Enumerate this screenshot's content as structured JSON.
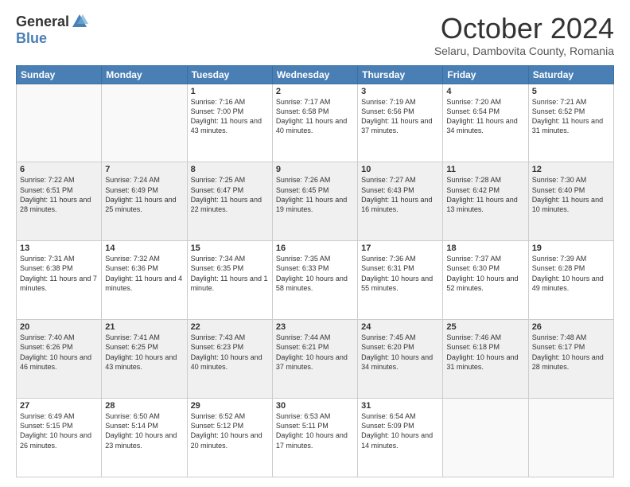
{
  "logo": {
    "general": "General",
    "blue": "Blue"
  },
  "title": "October 2024",
  "location": "Selaru, Dambovita County, Romania",
  "days_of_week": [
    "Sunday",
    "Monday",
    "Tuesday",
    "Wednesday",
    "Thursday",
    "Friday",
    "Saturday"
  ],
  "weeks": [
    [
      {
        "day": "",
        "info": ""
      },
      {
        "day": "",
        "info": ""
      },
      {
        "day": "1",
        "info": "Sunrise: 7:16 AM\nSunset: 7:00 PM\nDaylight: 11 hours and 43 minutes."
      },
      {
        "day": "2",
        "info": "Sunrise: 7:17 AM\nSunset: 6:58 PM\nDaylight: 11 hours and 40 minutes."
      },
      {
        "day": "3",
        "info": "Sunrise: 7:19 AM\nSunset: 6:56 PM\nDaylight: 11 hours and 37 minutes."
      },
      {
        "day": "4",
        "info": "Sunrise: 7:20 AM\nSunset: 6:54 PM\nDaylight: 11 hours and 34 minutes."
      },
      {
        "day": "5",
        "info": "Sunrise: 7:21 AM\nSunset: 6:52 PM\nDaylight: 11 hours and 31 minutes."
      }
    ],
    [
      {
        "day": "6",
        "info": "Sunrise: 7:22 AM\nSunset: 6:51 PM\nDaylight: 11 hours and 28 minutes."
      },
      {
        "day": "7",
        "info": "Sunrise: 7:24 AM\nSunset: 6:49 PM\nDaylight: 11 hours and 25 minutes."
      },
      {
        "day": "8",
        "info": "Sunrise: 7:25 AM\nSunset: 6:47 PM\nDaylight: 11 hours and 22 minutes."
      },
      {
        "day": "9",
        "info": "Sunrise: 7:26 AM\nSunset: 6:45 PM\nDaylight: 11 hours and 19 minutes."
      },
      {
        "day": "10",
        "info": "Sunrise: 7:27 AM\nSunset: 6:43 PM\nDaylight: 11 hours and 16 minutes."
      },
      {
        "day": "11",
        "info": "Sunrise: 7:28 AM\nSunset: 6:42 PM\nDaylight: 11 hours and 13 minutes."
      },
      {
        "day": "12",
        "info": "Sunrise: 7:30 AM\nSunset: 6:40 PM\nDaylight: 11 hours and 10 minutes."
      }
    ],
    [
      {
        "day": "13",
        "info": "Sunrise: 7:31 AM\nSunset: 6:38 PM\nDaylight: 11 hours and 7 minutes."
      },
      {
        "day": "14",
        "info": "Sunrise: 7:32 AM\nSunset: 6:36 PM\nDaylight: 11 hours and 4 minutes."
      },
      {
        "day": "15",
        "info": "Sunrise: 7:34 AM\nSunset: 6:35 PM\nDaylight: 11 hours and 1 minute."
      },
      {
        "day": "16",
        "info": "Sunrise: 7:35 AM\nSunset: 6:33 PM\nDaylight: 10 hours and 58 minutes."
      },
      {
        "day": "17",
        "info": "Sunrise: 7:36 AM\nSunset: 6:31 PM\nDaylight: 10 hours and 55 minutes."
      },
      {
        "day": "18",
        "info": "Sunrise: 7:37 AM\nSunset: 6:30 PM\nDaylight: 10 hours and 52 minutes."
      },
      {
        "day": "19",
        "info": "Sunrise: 7:39 AM\nSunset: 6:28 PM\nDaylight: 10 hours and 49 minutes."
      }
    ],
    [
      {
        "day": "20",
        "info": "Sunrise: 7:40 AM\nSunset: 6:26 PM\nDaylight: 10 hours and 46 minutes."
      },
      {
        "day": "21",
        "info": "Sunrise: 7:41 AM\nSunset: 6:25 PM\nDaylight: 10 hours and 43 minutes."
      },
      {
        "day": "22",
        "info": "Sunrise: 7:43 AM\nSunset: 6:23 PM\nDaylight: 10 hours and 40 minutes."
      },
      {
        "day": "23",
        "info": "Sunrise: 7:44 AM\nSunset: 6:21 PM\nDaylight: 10 hours and 37 minutes."
      },
      {
        "day": "24",
        "info": "Sunrise: 7:45 AM\nSunset: 6:20 PM\nDaylight: 10 hours and 34 minutes."
      },
      {
        "day": "25",
        "info": "Sunrise: 7:46 AM\nSunset: 6:18 PM\nDaylight: 10 hours and 31 minutes."
      },
      {
        "day": "26",
        "info": "Sunrise: 7:48 AM\nSunset: 6:17 PM\nDaylight: 10 hours and 28 minutes."
      }
    ],
    [
      {
        "day": "27",
        "info": "Sunrise: 6:49 AM\nSunset: 5:15 PM\nDaylight: 10 hours and 26 minutes."
      },
      {
        "day": "28",
        "info": "Sunrise: 6:50 AM\nSunset: 5:14 PM\nDaylight: 10 hours and 23 minutes."
      },
      {
        "day": "29",
        "info": "Sunrise: 6:52 AM\nSunset: 5:12 PM\nDaylight: 10 hours and 20 minutes."
      },
      {
        "day": "30",
        "info": "Sunrise: 6:53 AM\nSunset: 5:11 PM\nDaylight: 10 hours and 17 minutes."
      },
      {
        "day": "31",
        "info": "Sunrise: 6:54 AM\nSunset: 5:09 PM\nDaylight: 10 hours and 14 minutes."
      },
      {
        "day": "",
        "info": ""
      },
      {
        "day": "",
        "info": ""
      }
    ]
  ]
}
